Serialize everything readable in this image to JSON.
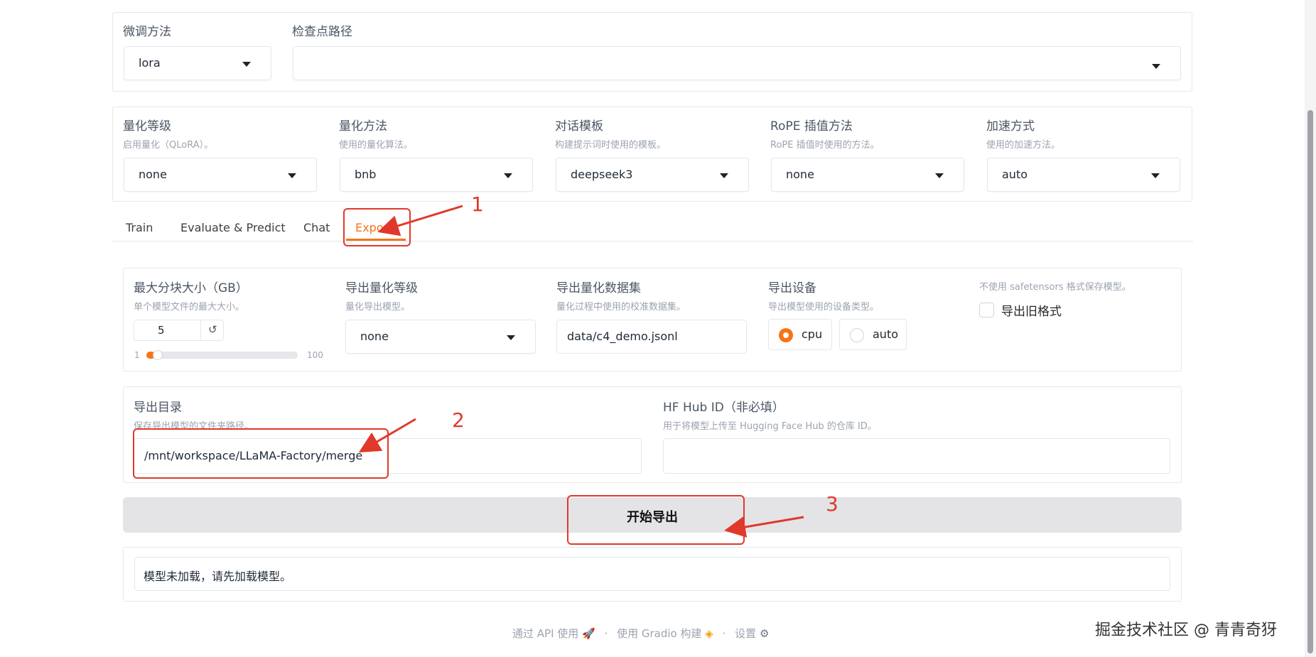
{
  "top": {
    "finetune_label": "微调方法",
    "finetune_value": "lora",
    "checkpoint_label": "检查点路径",
    "checkpoint_value": ""
  },
  "settings": [
    {
      "label": "量化等级",
      "info": "启用量化（QLoRA）。",
      "value": "none"
    },
    {
      "label": "量化方法",
      "info": "使用的量化算法。",
      "value": "bnb"
    },
    {
      "label": "对话模板",
      "info": "构建提示词时使用的模板。",
      "value": "deepseek3"
    },
    {
      "label": "RoPE 插值方法",
      "info": "RoPE 插值时使用的方法。",
      "value": "none"
    },
    {
      "label": "加速方式",
      "info": "使用的加速方法。",
      "value": "auto"
    }
  ],
  "tabs": [
    "Train",
    "Evaluate & Predict",
    "Chat",
    "Export"
  ],
  "active_tab": "Export",
  "export": {
    "max_shard_label": "最大分块大小（GB）",
    "max_shard_info": "单个模型文件的最大大小。",
    "max_shard_value": "5",
    "max_shard_min": "1",
    "max_shard_max": "100",
    "max_shard_reset": "↺",
    "slider_fraction": 0.04,
    "quant_bit_label": "导出量化等级",
    "quant_bit_info": "量化导出模型。",
    "quant_bit_value": "none",
    "quant_dataset_label": "导出量化数据集",
    "quant_dataset_info": "量化过程中使用的校准数据集。",
    "quant_dataset_value": "data/c4_demo.jsonl",
    "device_label": "导出设备",
    "device_info": "导出模型使用的设备类型。",
    "device_options": [
      "cpu",
      "auto"
    ],
    "device_selected": "cpu",
    "legacy_info": "不使用 safetensors 格式保存模型。",
    "legacy_label": "导出旧格式",
    "legacy_checked": false,
    "dir_label": "导出目录",
    "dir_info": "保存导出模型的文件夹路径。",
    "dir_value": "/mnt/workspace/LLaMA-Factory/merge",
    "hub_label": "HF Hub ID（非必填）",
    "hub_info": "用于将模型上传至 Hugging Face Hub 的仓库 ID。",
    "hub_value": "",
    "button": "开始导出",
    "output": "模型未加载，请先加载模型。"
  },
  "footer": {
    "api": "通过 API 使用",
    "gradio": "使用 Gradio 构建",
    "settings": "设置",
    "sep": "·"
  },
  "annotations": [
    "1",
    "2",
    "3"
  ],
  "watermark": "掘金技术社区 @ 青青奇犽",
  "colors": {
    "accent": "#f97316",
    "annotation": "#e0392b"
  }
}
